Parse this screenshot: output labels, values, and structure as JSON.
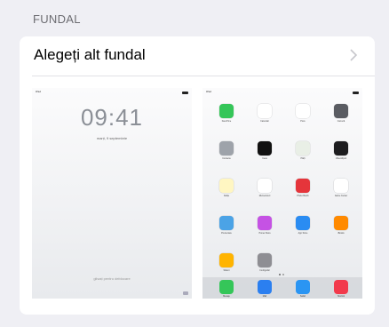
{
  "section": {
    "title": "FUNDAL"
  },
  "row": {
    "label": "Alegeți alt fundal",
    "chevron_icon": "chevron-right-icon"
  },
  "lock_preview": {
    "carrier": "iPad",
    "time": "09:41",
    "date": "marți, 9 septembrie",
    "slide_text": "glisați pentru deblocare"
  },
  "home_preview": {
    "carrier": "iPad",
    "apps": [
      {
        "label": "FaceTime",
        "color": "#35c659",
        "icon": "facetime-icon"
      },
      {
        "label": "Calendar",
        "color": "#ffffff",
        "icon": "calendar-icon"
      },
      {
        "label": "Poze",
        "color": "#ffffff",
        "icon": "photos-icon"
      },
      {
        "label": "Cameră",
        "color": "#5a5c62",
        "icon": "camera-icon"
      },
      {
        "label": "Contacte",
        "color": "#9ea3aa",
        "icon": "contacts-icon"
      },
      {
        "label": "Ceas",
        "color": "#111111",
        "icon": "clock-icon"
      },
      {
        "label": "Hărți",
        "color": "#e9efe6",
        "icon": "maps-icon"
      },
      {
        "label": "Videoclipuri",
        "color": "#1d1d1f",
        "icon": "videos-icon"
      },
      {
        "label": "Notițe",
        "color": "#fff6c2",
        "icon": "notes-icon"
      },
      {
        "label": "Mementouri",
        "color": "#ffffff",
        "icon": "reminders-icon"
      },
      {
        "label": "Photo Booth",
        "color": "#e5353b",
        "icon": "photo-booth-icon"
      },
      {
        "label": "Game Center",
        "color": "#ffffff",
        "icon": "game-center-icon"
      },
      {
        "label": "Prezentare",
        "color": "#4ba3e6",
        "icon": "newsstand-icon"
      },
      {
        "label": "iTunes Store",
        "color": "#c552e4",
        "icon": "itunes-store-icon"
      },
      {
        "label": "App Store",
        "color": "#2a8cf2",
        "icon": "app-store-icon"
      },
      {
        "label": "iBooks",
        "color": "#ff8a00",
        "icon": "ibooks-icon"
      },
      {
        "label": "Sfaturi",
        "color": "#ffb400",
        "icon": "tips-icon"
      },
      {
        "label": "Configurări",
        "color": "#8e8e93",
        "icon": "settings-icon"
      }
    ],
    "dock": [
      {
        "label": "Mesaje",
        "color": "#35c659",
        "icon": "messages-icon"
      },
      {
        "label": "Mail",
        "color": "#2b7ff0",
        "icon": "mail-icon"
      },
      {
        "label": "Safari",
        "color": "#2a95f3",
        "icon": "safari-icon"
      },
      {
        "label": "Muzică",
        "color": "#f23a4c",
        "icon": "music-icon"
      }
    ]
  }
}
